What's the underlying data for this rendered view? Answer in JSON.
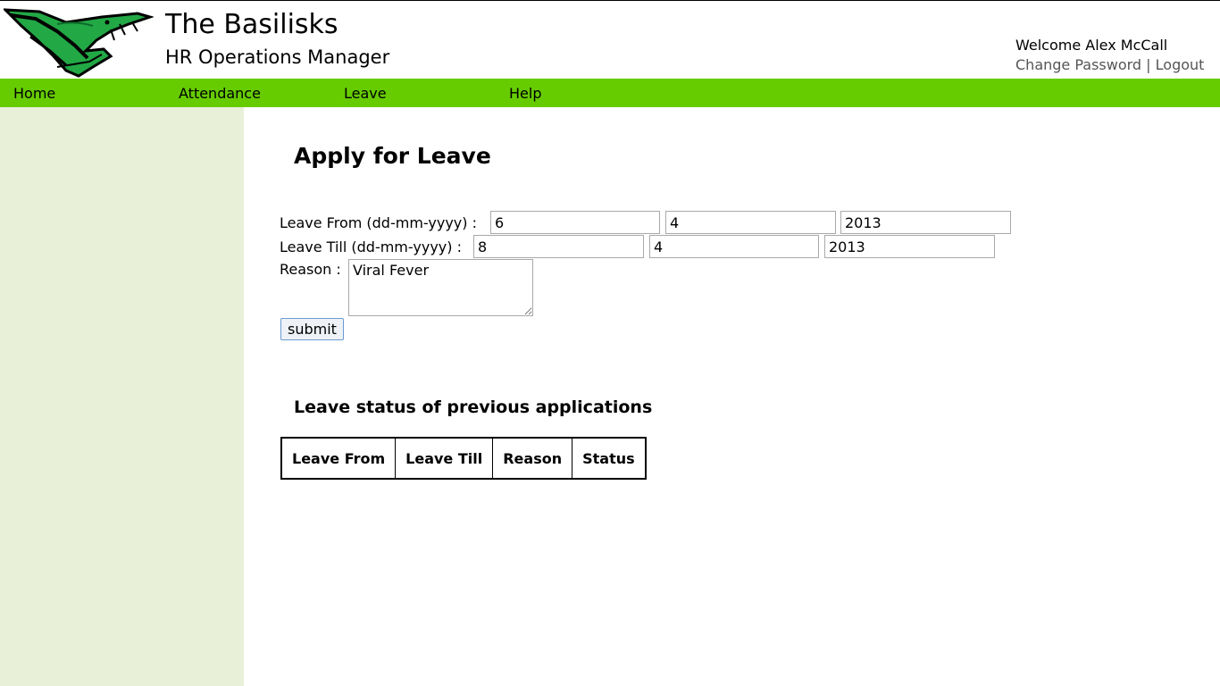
{
  "brand": {
    "name": "The Basilisks",
    "subtitle": "HR Operations Manager"
  },
  "user": {
    "welcome": "Welcome Alex McCall",
    "change_password": "Change Password",
    "separator": "|",
    "logout": "Logout"
  },
  "nav": [
    {
      "label": "Home"
    },
    {
      "label": "Attendance"
    },
    {
      "label": "Leave"
    },
    {
      "label": "Help"
    }
  ],
  "form": {
    "title": "Apply for Leave",
    "leave_from_label": "Leave From (dd-mm-yyyy) :",
    "leave_from": {
      "day": "6",
      "month": "4",
      "year": "2013"
    },
    "leave_till_label": "Leave Till (dd-mm-yyyy) :",
    "leave_till": {
      "day": "8",
      "month": "4",
      "year": "2013"
    },
    "reason_label": "Reason :",
    "reason": "Viral Fever",
    "submit_label": "submit"
  },
  "history": {
    "title": "Leave status of previous applications",
    "columns": [
      "Leave From",
      "Leave Till",
      "Reason",
      "Status"
    ],
    "rows": []
  },
  "colors": {
    "nav_bg": "#66cc00",
    "sidebar_bg": "#e8f0d8",
    "logo_green": "#22a845"
  },
  "icons": {
    "logo": "basilisk-serpent-logo"
  }
}
